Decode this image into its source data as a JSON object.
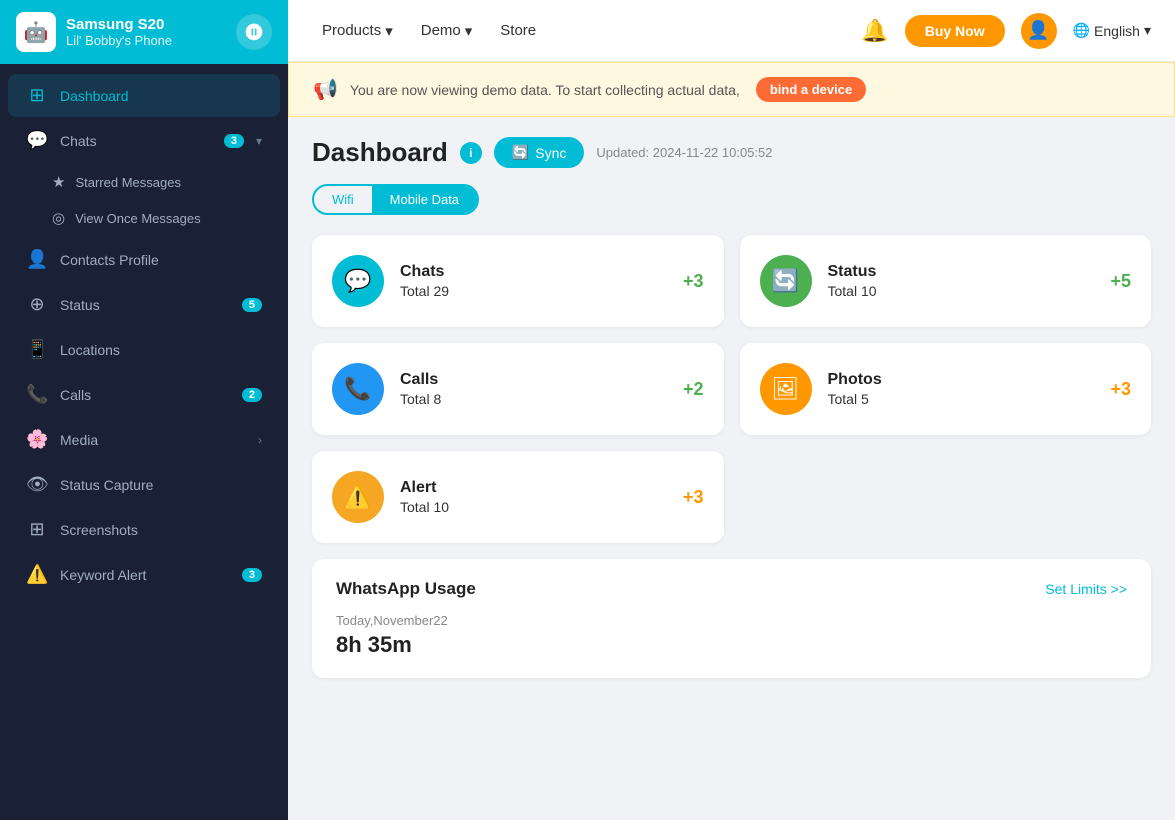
{
  "app": {
    "device_name": "Samsung S20",
    "device_sub": "Lil' Bobby's Phone",
    "device_icon": "📱"
  },
  "topnav": {
    "links": [
      {
        "label": "Products",
        "has_chevron": true
      },
      {
        "label": "Demo",
        "has_chevron": true
      },
      {
        "label": "Store",
        "has_chevron": false
      }
    ],
    "buy_now": "Buy Now",
    "language": "English",
    "language_icon": "🌐"
  },
  "banner": {
    "text": "You are now viewing demo data. To start collecting actual data,",
    "cta": "bind a device",
    "icon": "📢"
  },
  "dashboard": {
    "title": "Dashboard",
    "sync_label": "Sync",
    "updated_text": "Updated: 2024-11-22 10:05:52",
    "toggle": {
      "wifi": "Wifi",
      "mobile": "Mobile Data",
      "active": "mobile"
    },
    "stats": [
      {
        "id": "chats",
        "name": "Chats",
        "total_label": "Total",
        "total": "29",
        "delta": "+3",
        "delta_class": "positive-green",
        "icon": "💬",
        "icon_class": "chats"
      },
      {
        "id": "status",
        "name": "Status",
        "total_label": "Total",
        "total": "10",
        "delta": "+5",
        "delta_class": "positive-green",
        "icon": "🔄",
        "icon_class": "status"
      },
      {
        "id": "calls",
        "name": "Calls",
        "total_label": "Total",
        "total": "8",
        "delta": "+2",
        "delta_class": "positive-green",
        "icon": "📞",
        "icon_class": "calls"
      },
      {
        "id": "photos",
        "name": "Photos",
        "total_label": "Total",
        "total": "5",
        "delta": "+3",
        "delta_class": "positive-orange",
        "icon": "🖼",
        "icon_class": "photos"
      }
    ],
    "alert": {
      "id": "alert",
      "name": "Alert",
      "total_label": "Total",
      "total": "10",
      "delta": "+3",
      "delta_class": "positive-orange",
      "icon": "⚠️",
      "icon_class": "alert"
    },
    "whatsapp_usage": {
      "title": "WhatsApp Usage",
      "set_limits": "Set Limits >>",
      "date": "Today,November22",
      "time": "8h 35m"
    }
  },
  "sidebar": {
    "dashboard_label": "Dashboard",
    "items": [
      {
        "id": "chats",
        "label": "Chats",
        "icon": "💬",
        "badge": "3",
        "has_sub": true,
        "active": false
      },
      {
        "id": "contacts",
        "label": "Contacts Profile",
        "icon": "👤",
        "badge": null,
        "has_sub": false,
        "active": false
      },
      {
        "id": "status",
        "label": "Status",
        "icon": "⊕",
        "badge": "5",
        "has_sub": false,
        "active": false
      },
      {
        "id": "locations",
        "label": "Locations",
        "icon": "📱",
        "badge": null,
        "has_sub": false,
        "active": false
      },
      {
        "id": "calls",
        "label": "Calls",
        "icon": "📞",
        "badge": "2",
        "has_sub": false,
        "active": false
      },
      {
        "id": "media",
        "label": "Media",
        "icon": "🌸",
        "badge": null,
        "has_sub": true,
        "active": false
      },
      {
        "id": "status-capture",
        "label": "Status Capture",
        "icon": "👁",
        "badge": null,
        "has_sub": false,
        "active": false
      },
      {
        "id": "screenshots",
        "label": "Screenshots",
        "icon": "⊞",
        "badge": null,
        "has_sub": false,
        "active": false
      },
      {
        "id": "keyword-alert",
        "label": "Keyword Alert",
        "icon": "⚠️",
        "badge": "3",
        "has_sub": false,
        "active": false
      }
    ],
    "sub_items": [
      {
        "id": "starred",
        "label": "Starred Messages",
        "icon": "★"
      },
      {
        "id": "view-once",
        "label": "View Once Messages",
        "icon": "⊙"
      }
    ]
  }
}
